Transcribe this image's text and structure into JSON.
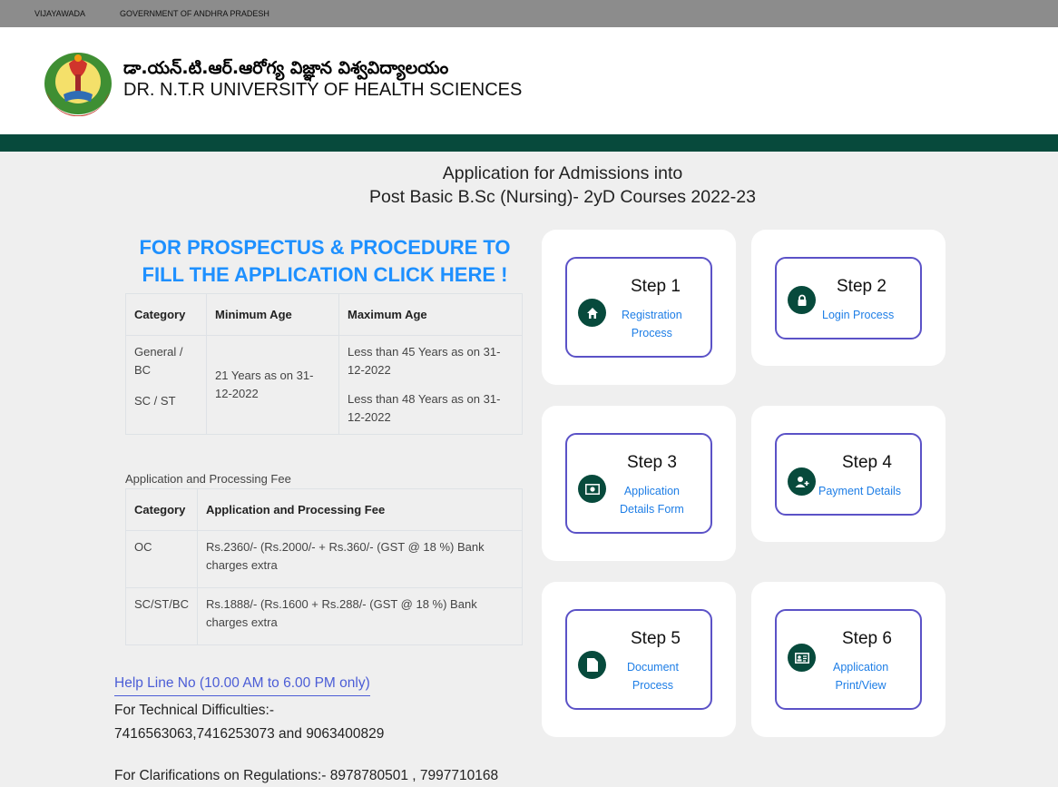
{
  "topbar": {
    "link1": "VIJAYAWADA",
    "link2": "GOVERNMENT OF ANDHRA PRADESH"
  },
  "header": {
    "university_telugu": "డా.యన్.టి.ఆర్.ఆరోగ్య విజ్ఞాన విశ్వవిద్యాలయం",
    "university_english": "DR. N.T.R UNIVERSITY OF HEALTH SCIENCES"
  },
  "page": {
    "title_line1": "Application for Admissions into",
    "title_line2": "Post Basic B.Sc (Nursing)- 2yD Courses 2022-23",
    "prospectus_link": "FOR PROSPECTUS & PROCEDURE TO FILL THE APPLICATION CLICK HERE !"
  },
  "age_table": {
    "headers": [
      "Category",
      "Minimum Age",
      "Maximum Age"
    ],
    "category1": "General / BC",
    "category2": "SC / ST",
    "min_age": "21 Years as on 31-12-2022",
    "max_age1": "Less than 45 Years as on 31-12-2022",
    "max_age2": "Less than 48 Years as on 31-12-2022"
  },
  "fee_table": {
    "caption": "Application and Processing Fee",
    "headers": [
      "Category",
      "Application and Processing Fee"
    ],
    "rows": [
      {
        "category": "OC",
        "fee": "Rs.2360/- (Rs.2000/- + Rs.360/- (GST @ 18 %) Bank charges extra"
      },
      {
        "category": "SC/ST/BC",
        "fee": "Rs.1888/- (Rs.1600 + Rs.288/- (GST @ 18 %) Bank charges extra"
      }
    ]
  },
  "helpline": {
    "link": "Help Line No (10.00 AM to 6.00 PM only)",
    "tech_label": "For Technical Difficulties:-",
    "tech_numbers": "7416563063,7416253073 and 9063400829",
    "clarifications": "For Clarifications on Regulations:- 8978780501 , 7997710168"
  },
  "steps": [
    {
      "title": "Step 1",
      "line1": "Registration",
      "line2": "Process",
      "icon": "home-icon"
    },
    {
      "title": "Step 2",
      "line1": "Login Process",
      "line2": "",
      "icon": "lock-icon"
    },
    {
      "title": "Step 3",
      "line1": "Application",
      "line2": "Details Form",
      "icon": "money-icon"
    },
    {
      "title": "Step 4",
      "line1": "Payment Details",
      "line2": "",
      "icon": "user-plus-icon"
    },
    {
      "title": "Step 5",
      "line1": "Document",
      "line2": "Process",
      "icon": "file-icon"
    },
    {
      "title": "Step 6",
      "line1": "Application",
      "line2": "Print/View",
      "icon": "id-card-icon"
    }
  ],
  "colors": {
    "accent_green": "#074a3c",
    "step_border": "#5b52c7",
    "link_blue": "#1e90ff",
    "sub_blue": "#1e7ee6"
  }
}
